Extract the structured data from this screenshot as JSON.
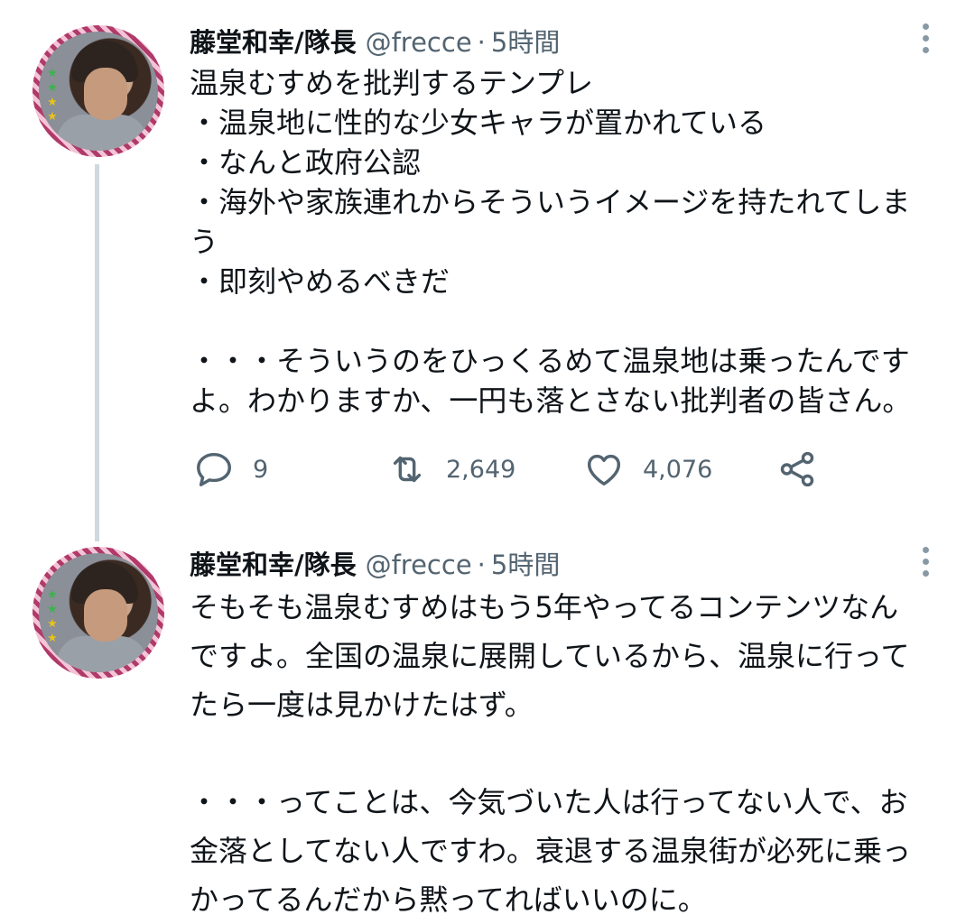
{
  "tweets": [
    {
      "author_name": "藤堂和幸/隊長",
      "handle": "@frecce",
      "dot": "·",
      "time": "5時間",
      "text": "温泉むすめを批判するテンプレ\n・温泉地に性的な少女キャラが置かれている\n・なんと政府公認\n・海外や家族連れからそういうイメージを持たれてしま\nう\n・即刻やめるべきだ\n\n・・・そういうのをひっくるめて温泉地は乗ったんです\nよ。わかりますか、一円も落とさない批判者の皆さん。",
      "actions": {
        "reply_count": "9",
        "retweet_count": "2,649",
        "like_count": "4,076"
      }
    },
    {
      "author_name": "藤堂和幸/隊長",
      "handle": "@frecce",
      "dot": "·",
      "time": "5時間",
      "text": "そもそも温泉むすめはもう5年やってるコンテンツなん\nですよ。全国の温泉に展開しているから、温泉に行って\nたら一度は見かけたはず。\n\n・・・ってことは、今気づいた人は行ってない人で、お\n金落としてない人ですわ。衰退する温泉街が必死に乗っ\nかってるんだから黙ってればいいのに。"
    }
  ],
  "icons": {
    "reply": "reply-icon",
    "retweet": "retweet-icon",
    "like": "heart-icon",
    "share": "share-icon",
    "more": "more-vertical-icon"
  },
  "colors": {
    "text_primary": "#0f1419",
    "text_secondary": "#536471",
    "thread_line": "#cfd9de"
  }
}
